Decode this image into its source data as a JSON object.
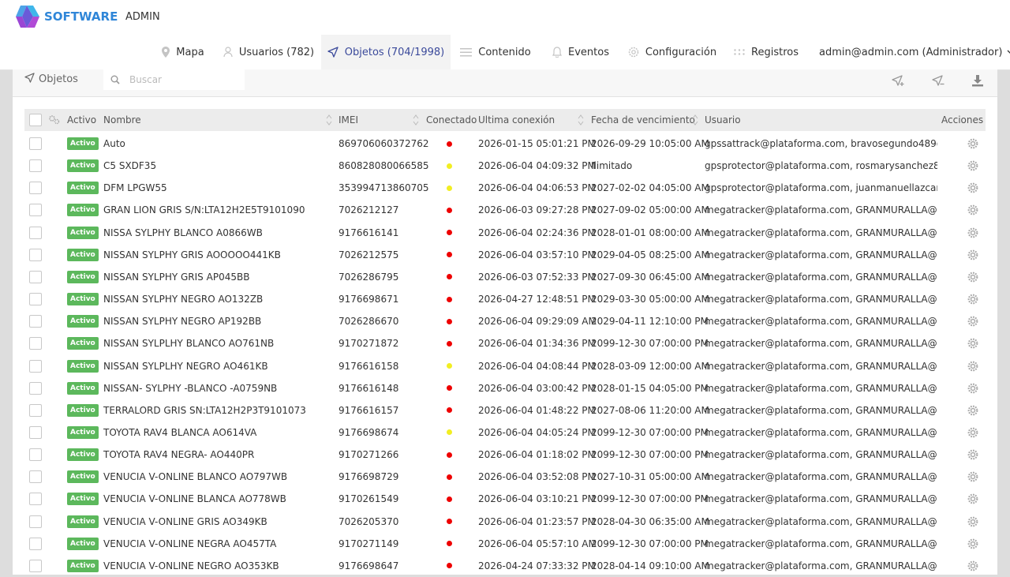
{
  "brand": {
    "name": "SOFTWARE",
    "admin_label": "ADMIN"
  },
  "colors": {
    "active_badge": "#5cb85c",
    "dot_red": "#ee0000",
    "dot_yellow": "#f2ee22",
    "nav_active": "#3b4a9b"
  },
  "nav": [
    {
      "label": "Mapa",
      "icon": "map-pin-icon",
      "active": false
    },
    {
      "label": "Usuarios (782)",
      "icon": "user-icon",
      "active": false
    },
    {
      "label": "Objetos (704/1998)",
      "icon": "navigation-arrow-icon",
      "active": true
    },
    {
      "label": "Contenido",
      "icon": "menu-lines-icon",
      "active": false
    },
    {
      "label": "Eventos",
      "icon": "bell-icon",
      "active": false
    },
    {
      "label": "Configuración",
      "icon": "gear-icon",
      "active": false
    },
    {
      "label": "Registros",
      "icon": "dots-grid-icon",
      "active": false
    }
  ],
  "user_menu": "admin@admin.com (Administrador)",
  "toolbar": {
    "title": "Objetos",
    "search_placeholder": "Buscar"
  },
  "columns": {
    "activo": "Activo",
    "nombre": "Nombre",
    "imei": "IMEI",
    "conectado": "Conectado",
    "ultima": "Ultima conexión",
    "vencimiento": "Fecha de vencimiento",
    "usuario": "Usuario",
    "acciones": "Acciones"
  },
  "rows": [
    {
      "status": "Activo",
      "name": "Auto",
      "imei": "869706060372762",
      "connected": "red",
      "last": "2026-01-15 05:01:21 PM",
      "expiry": "2026-09-29 10:05:00 AM",
      "user": "gpssattrack@plataforma.com, bravosegundo489@..."
    },
    {
      "status": "Activo",
      "name": "C5 SXDF35",
      "imei": "860828080066585",
      "connected": "yellow",
      "last": "2026-06-04 04:09:32 PM",
      "expiry": "Ilimitado",
      "user": "gpsprotector@plataforma.com, rosmarysanchez82..."
    },
    {
      "status": "Activo",
      "name": "DFM LPGW55",
      "imei": "353994713860705",
      "connected": "yellow",
      "last": "2026-06-04 04:06:53 PM",
      "expiry": "2027-02-02 04:05:00 AM",
      "user": "gpsprotector@plataforma.com, juanmanuellazcan..."
    },
    {
      "status": "Activo",
      "name": "GRAN LION GRIS S/N:LTA12H2E5T9101090",
      "imei": "7026212127",
      "connected": "red",
      "last": "2026-06-03 09:27:28 PM",
      "expiry": "2027-09-02 05:00:00 AM",
      "user": "megatracker@plataforma.com, GRANMURALLA@P..."
    },
    {
      "status": "Activo",
      "name": "NISSA SYLPHY BLANCO A0866WB",
      "imei": "9176616141",
      "connected": "red",
      "last": "2026-06-04 02:24:36 PM",
      "expiry": "2028-01-01 08:00:00 AM",
      "user": "megatracker@plataforma.com, GRANMURALLA@P..."
    },
    {
      "status": "Activo",
      "name": "NISSAN SYLPHY GRIS AOOOOO441KB",
      "imei": "7026212575",
      "connected": "red",
      "last": "2026-06-04 03:57:10 PM",
      "expiry": "2029-04-05 08:25:00 AM",
      "user": "megatracker@plataforma.com, GRANMURALLA@P..."
    },
    {
      "status": "Activo",
      "name": "NISSAN SYLPHY GRIS AP045BB",
      "imei": "7026286795",
      "connected": "red",
      "last": "2026-06-03 07:52:33 PM",
      "expiry": "2027-09-30 06:45:00 AM",
      "user": "megatracker@plataforma.com, GRANMURALLA@P..."
    },
    {
      "status": "Activo",
      "name": "NISSAN SYLPHY NEGRO AO132ZB",
      "imei": "9176698671",
      "connected": "red",
      "last": "2026-04-27 12:48:51 PM",
      "expiry": "2029-03-30 05:00:00 AM",
      "user": "megatracker@plataforma.com, GRANMURALLA@P..."
    },
    {
      "status": "Activo",
      "name": "NISSAN SYLPHY NEGRO AP192BB",
      "imei": "7026286670",
      "connected": "red",
      "last": "2026-06-04 09:29:09 AM",
      "expiry": "2029-04-11 12:10:00 PM",
      "user": "megatracker@plataforma.com, GRANMURALLA@P..."
    },
    {
      "status": "Activo",
      "name": "NISSAN SYLPLHY BLANCO AO761NB",
      "imei": "9170271872",
      "connected": "red",
      "last": "2026-06-04 01:34:36 PM",
      "expiry": "2099-12-30 07:00:00 PM",
      "user": "megatracker@plataforma.com, GRANMURALLA@P..."
    },
    {
      "status": "Activo",
      "name": "NISSAN SYLPLHY NEGRO AO461KB",
      "imei": "9176616158",
      "connected": "yellow",
      "last": "2026-06-04 04:08:44 PM",
      "expiry": "2028-03-09 12:00:00 AM",
      "user": "megatracker@plataforma.com, GRANMURALLA@P..."
    },
    {
      "status": "Activo",
      "name": "NISSAN- SYLPHY -BLANCO -A0759NB",
      "imei": "9176616148",
      "connected": "red",
      "last": "2026-06-04 03:00:42 PM",
      "expiry": "2028-01-15 04:05:00 PM",
      "user": "megatracker@plataforma.com, GRANMURALLA@P..."
    },
    {
      "status": "Activo",
      "name": "TERRALORD GRIS SN:LTA12H2P3T9101073",
      "imei": "9176616157",
      "connected": "red",
      "last": "2026-06-04 01:48:22 PM",
      "expiry": "2027-08-06 11:20:00 AM",
      "user": "megatracker@plataforma.com, GRANMURALLA@P..."
    },
    {
      "status": "Activo",
      "name": "TOYOTA RAV4 BLANCA AO614VA",
      "imei": "9176698674",
      "connected": "yellow",
      "last": "2026-06-04 04:05:24 PM",
      "expiry": "2099-12-30 07:00:00 PM",
      "user": "megatracker@plataforma.com, GRANMURALLA@P..."
    },
    {
      "status": "Activo",
      "name": "TOYOTA RAV4 NEGRA- AO440PR",
      "imei": "9170271266",
      "connected": "red",
      "last": "2026-06-04 01:18:02 PM",
      "expiry": "2099-12-30 07:00:00 PM",
      "user": "megatracker@plataforma.com, GRANMURALLA@P..."
    },
    {
      "status": "Activo",
      "name": "VENUCIA V-ONLINE BLANCO AO797WB",
      "imei": "9176698729",
      "connected": "red",
      "last": "2026-06-04 03:52:08 PM",
      "expiry": "2027-10-31 05:00:00 AM",
      "user": "megatracker@plataforma.com, GRANMURALLA@P..."
    },
    {
      "status": "Activo",
      "name": "VENUCIA V-ONLINE BLANCA AO778WB",
      "imei": "9170261549",
      "connected": "red",
      "last": "2026-06-04 03:10:21 PM",
      "expiry": "2099-12-30 07:00:00 PM",
      "user": "megatracker@plataforma.com, GRANMURALLA@P..."
    },
    {
      "status": "Activo",
      "name": "VENUCIA V-ONLINE GRIS AO349KB",
      "imei": "7026205370",
      "connected": "red",
      "last": "2026-06-04 01:23:57 PM",
      "expiry": "2028-04-30 06:35:00 AM",
      "user": "megatracker@plataforma.com, GRANMURALLA@P..."
    },
    {
      "status": "Activo",
      "name": "VENUCIA V-ONLINE NEGRA AO457TA",
      "imei": "9170271149",
      "connected": "red",
      "last": "2026-06-04 05:57:10 AM",
      "expiry": "2099-12-30 07:00:00 PM",
      "user": "megatracker@plataforma.com, GRANMURALLA@P..."
    },
    {
      "status": "Activo",
      "name": "VENUCIA V-ONLINE NEGRO AO353KB",
      "imei": "9176698647",
      "connected": "red",
      "last": "2026-04-24 07:33:32 PM",
      "expiry": "2028-04-14 09:10:00 AM",
      "user": "megatracker@plataforma.com, GRANMURALLA@P..."
    }
  ]
}
